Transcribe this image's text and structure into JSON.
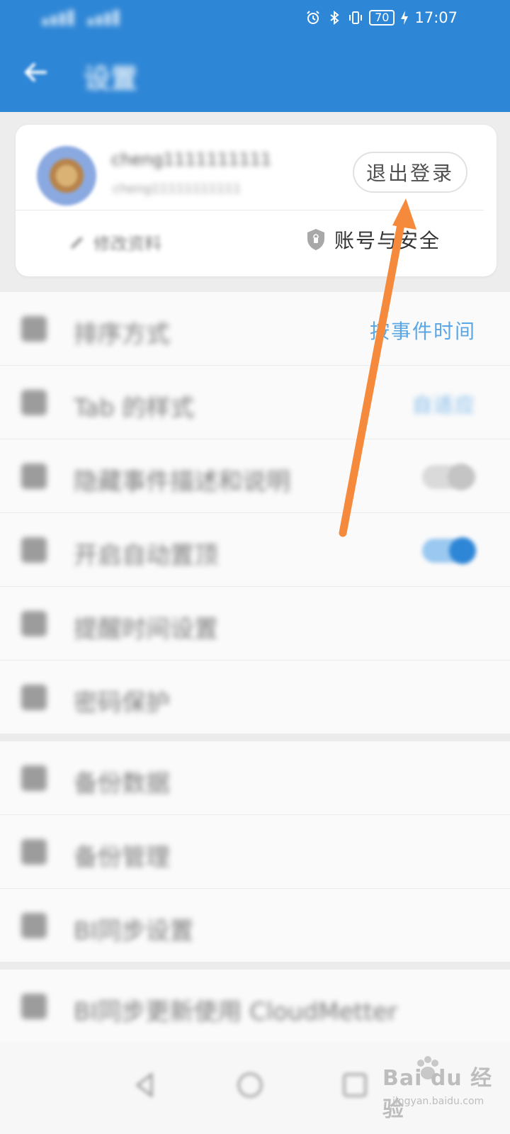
{
  "status_bar": {
    "battery": "70",
    "time": "17:07"
  },
  "app_bar": {
    "title": "设置"
  },
  "account_card": {
    "username": "cheng1111111111",
    "sub_text": "cheng11111111111",
    "logout_label": "退出登录",
    "edit_profile_label": "修改资料",
    "security_label": "账号与安全"
  },
  "settings": {
    "items": [
      {
        "label": "排序方式",
        "value": "按事件时间",
        "icon": "sort-icon"
      },
      {
        "label": "Tab 的样式",
        "value": "自适应",
        "icon": "tab-style-icon"
      },
      {
        "label": "隐藏事件描述和说明",
        "toggle": "off",
        "icon": "hide-icon"
      },
      {
        "label": "开启自动置顶",
        "toggle": "on",
        "icon": "pin-icon"
      },
      {
        "label": "提醒时间设置",
        "icon": "clock-icon"
      },
      {
        "label": "密码保护",
        "icon": "key-icon"
      },
      {
        "label": "备份数据",
        "icon": "backup-icon"
      },
      {
        "label": "备份管理",
        "icon": "backup-manage-icon"
      },
      {
        "label": "BI同步设置",
        "icon": "sync-icon"
      },
      {
        "label": "BI同步更新使用 CloudMetter",
        "icon": "cloud-icon"
      }
    ]
  },
  "watermark": {
    "brand": "Bai du 经验",
    "url": "jingyan.baidu.com"
  },
  "colors": {
    "primary": "#2e86d6",
    "accent_text": "#5aa6e6",
    "arrow": "#f58a3c"
  }
}
